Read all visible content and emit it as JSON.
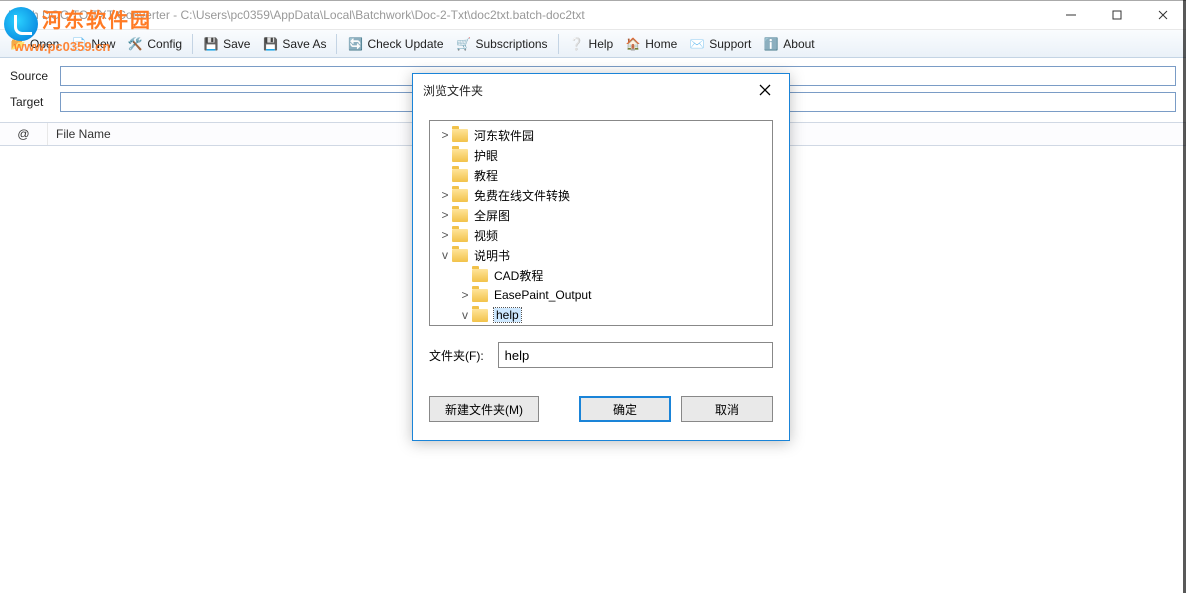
{
  "window": {
    "title": "Batch DOC TO TXT Converter - C:\\Users\\pc0359\\AppData\\Local\\Batchwork\\Doc-2-Txt\\doc2txt.batch-doc2txt"
  },
  "watermark": {
    "text": "河东软件园",
    "url": "www.pc0359.cn"
  },
  "toolbar": {
    "open": "Open",
    "new": "New",
    "config": "Config",
    "save": "Save",
    "save_as": "Save As",
    "check_update": "Check Update",
    "subscriptions": "Subscriptions",
    "help": "Help",
    "home": "Home",
    "support": "Support",
    "about": "About"
  },
  "paths": {
    "source_label": "Source",
    "source_value": "",
    "target_label": "Target",
    "target_value": ""
  },
  "list": {
    "col_at": "@",
    "col_filename": "File Name"
  },
  "dialog": {
    "title": "浏览文件夹",
    "tree": [
      {
        "label": "河东软件园",
        "level": 1,
        "arrow": ">"
      },
      {
        "label": "护眼",
        "level": 1,
        "arrow": ""
      },
      {
        "label": "教程",
        "level": 1,
        "arrow": ""
      },
      {
        "label": "免费在线文件转换",
        "level": 1,
        "arrow": ">"
      },
      {
        "label": "全屏图",
        "level": 1,
        "arrow": ">"
      },
      {
        "label": "视频",
        "level": 1,
        "arrow": ">"
      },
      {
        "label": "说明书",
        "level": 1,
        "arrow": "v"
      },
      {
        "label": "CAD教程",
        "level": 2,
        "arrow": ""
      },
      {
        "label": "EasePaint_Output",
        "level": 2,
        "arrow": ">"
      },
      {
        "label": "help",
        "level": 2,
        "arrow": "v",
        "selected": true
      }
    ],
    "folder_label": "文件夹(F):",
    "folder_value": "help",
    "new_folder": "新建文件夹(M)",
    "ok": "确定",
    "cancel": "取消"
  }
}
